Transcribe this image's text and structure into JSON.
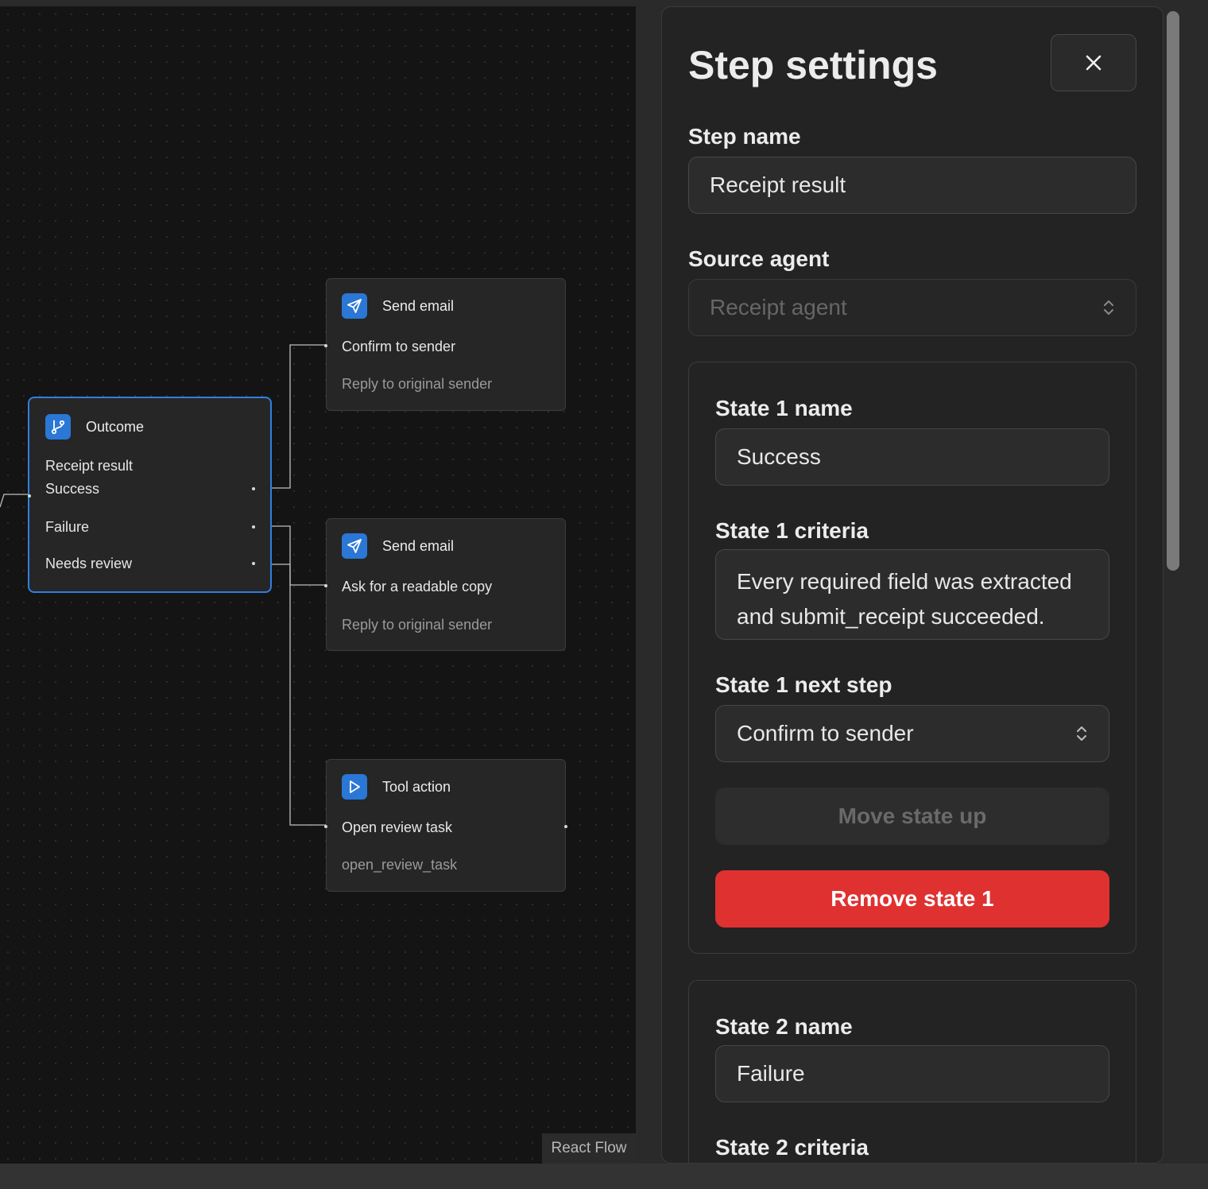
{
  "canvas": {
    "attribution": "React Flow",
    "accent_color": "#2f7fe0",
    "nodes": [
      {
        "type": "Outcome",
        "icon": "branch-icon",
        "title": "Receipt result",
        "outputs": [
          "Success",
          "Failure",
          "Needs review"
        ],
        "selected": true
      },
      {
        "type": "Send email",
        "icon": "send-icon",
        "title": "Confirm to sender",
        "subtitle": "Reply to original sender"
      },
      {
        "type": "Send email",
        "icon": "send-icon",
        "title": "Ask for a readable copy",
        "subtitle": "Reply to original sender"
      },
      {
        "type": "Tool action",
        "icon": "play-icon",
        "title": "Open review task",
        "subtitle": "open_review_task"
      }
    ]
  },
  "panel": {
    "title": "Step settings",
    "close_icon": "close-icon",
    "step_name_label": "Step name",
    "step_name_value": "Receipt result",
    "source_agent_label": "Source agent",
    "source_agent_value": "Receipt agent",
    "states": [
      {
        "name_label": "State 1 name",
        "name_value": "Success",
        "criteria_label": "State 1 criteria",
        "criteria_value": "Every required field was extracted and submit_receipt succeeded.",
        "next_step_label": "State 1 next step",
        "next_step_value": "Confirm to sender",
        "move_up_label": "Move state up",
        "remove_label": "Remove state 1"
      },
      {
        "name_label": "State 2 name",
        "name_value": "Failure",
        "criteria_label": "State 2 criteria"
      }
    ],
    "danger_color": "#e03131"
  }
}
